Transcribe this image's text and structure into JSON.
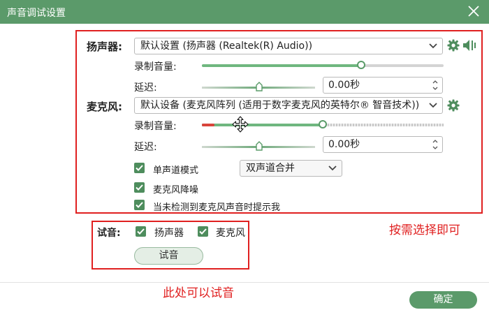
{
  "window": {
    "title": "声音调试设置"
  },
  "speaker": {
    "label": "扬声器:",
    "device": "默认设置 (扬声器 (Realtek(R) Audio))",
    "record_volume_label": "录制音量:",
    "record_volume_level": 0.66,
    "delay_label": "延迟:",
    "delay_value": "0.00秒"
  },
  "microphone": {
    "label": "麦克风:",
    "device": "默认设备 (麦克风阵列 (适用于数字麦克风的英特尔® 智音技术))",
    "record_volume_label": "录制音量:",
    "record_volume_level": 0.5,
    "delay_label": "延迟:",
    "delay_value": "0.00秒"
  },
  "options": {
    "mono_mode": {
      "label": "单声道模式",
      "checked": true
    },
    "channel_select": "双声道合并",
    "noise_reduction": {
      "label": "麦克风降噪",
      "checked": true
    },
    "no_mic_prompt": {
      "label": "当未检测到麦克风声音时提示我",
      "checked": true
    }
  },
  "audition": {
    "label": "试音:",
    "speaker": {
      "label": "扬声器",
      "checked": true
    },
    "microphone": {
      "label": "麦克风",
      "checked": true
    },
    "button": "试音"
  },
  "annotations": {
    "select_as_needed": "按需选择即可",
    "audition_here": "此处可以试音"
  },
  "footer": {
    "ok_button": "确定"
  },
  "colors": {
    "accent": "#5b9a6a",
    "annotation_red": "#e02020"
  },
  "icons": {
    "settings": "gear-icon",
    "speaker_test": "speaker-volume-icon",
    "close": "close-icon",
    "move_cursor": "move-cursor-icon"
  }
}
